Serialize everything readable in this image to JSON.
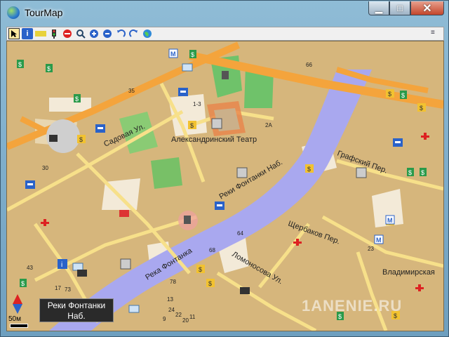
{
  "window": {
    "title": "TourMap",
    "min_label": "▁",
    "max_label": "□",
    "close_label": "✕"
  },
  "toolbar": {
    "items": [
      "pointer-tool",
      "info-tool",
      "ruler-tool",
      "traffic-light-tool",
      "stop-tool",
      "magnifier-tool",
      "zoom-in-tool",
      "zoom-out-tool",
      "undo-tool",
      "redo-tool",
      "globe-tool"
    ],
    "menu_icon": "≡"
  },
  "map": {
    "streets": {
      "sadovaya": "Садовая Ул.",
      "fontanka_quay": "Реки Фонтанки Наб.",
      "fontanka_river": "Река Фонтанка",
      "grafsky": "Графский Пер.",
      "shcherbakov": "Щербаков Пер.",
      "lomonosova": "Ломоносова Ул.",
      "vladimirskaya": "Владимирская"
    },
    "landmarks": {
      "theatre": "Александринский Театр"
    },
    "house_numbers": [
      "66",
      "35",
      "1-3",
      "2А",
      "30",
      "64",
      "23",
      "17",
      "73",
      "78",
      "68",
      "24",
      "22",
      "20",
      "11",
      "9",
      "13",
      "43"
    ],
    "metro_label": "M"
  },
  "infobox": {
    "line1": "Реки Фонтанки",
    "line2": "Наб."
  },
  "scale": {
    "label": "50м"
  },
  "watermark": "1ANENIE.RU"
}
